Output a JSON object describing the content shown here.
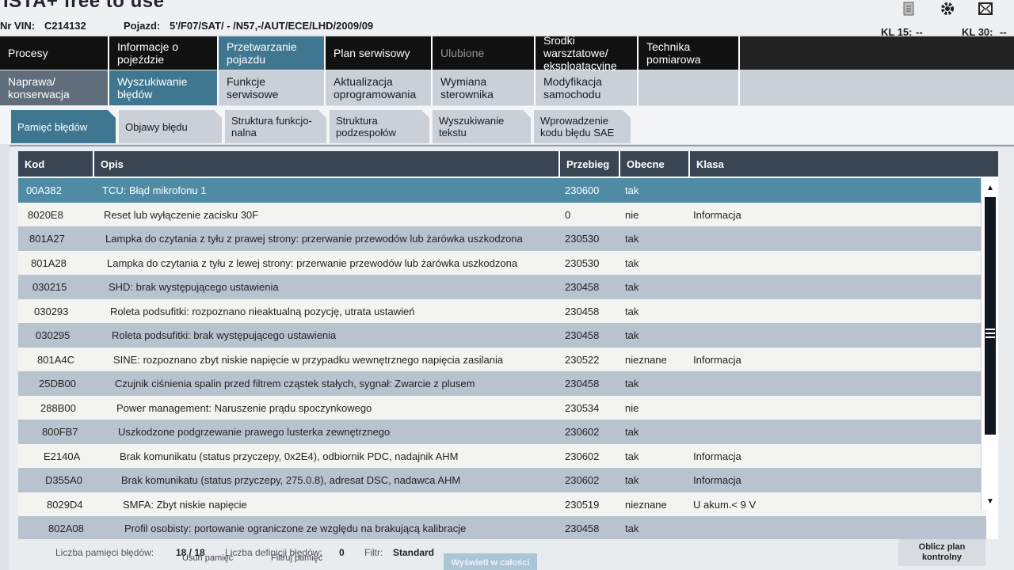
{
  "app": {
    "title": "ISTA+ free to use"
  },
  "top_icons": [
    "document-icon",
    "gear-icon",
    "mail-icon"
  ],
  "vehicle": {
    "vin_label": "Nr VIN:",
    "vin": "C214132",
    "vehicle_label": "Pojazd:",
    "vehicle": "5'/F07/SAT/ - /N57,-/AUT/ECE/LHD/2009/09",
    "kl15_label": "KL 15:",
    "kl15": "--",
    "kl30_label": "KL 30:",
    "kl30": "--"
  },
  "nav_main": [
    {
      "label": "Procesy"
    },
    {
      "label": "Informacje o pojeździe"
    },
    {
      "label": "Przetwarzanie pojazdu"
    },
    {
      "label": "Plan serwisowy"
    },
    {
      "label": "Ulubione"
    },
    {
      "label": "Środki warsztatowe/ eksploatacyjne"
    },
    {
      "label": "Technika pomiarowa"
    }
  ],
  "nav_sub": [
    {
      "label": "Naprawa/ konserwacja"
    },
    {
      "label": "Wyszukiwanie błędów"
    },
    {
      "label": "Funkcje serwisowe"
    },
    {
      "label": "Aktualizacja oprogramowania"
    },
    {
      "label": "Wymiana sterownika"
    },
    {
      "label": "Modyfikacja samochodu"
    }
  ],
  "subtabs": [
    {
      "label": "Pamięć błędów"
    },
    {
      "label": "Objawy błędu"
    },
    {
      "label": "Struktura funkcjo- nalna"
    },
    {
      "label": "Struktura podzespołów"
    },
    {
      "label": "Wyszukiwanie tekstu"
    },
    {
      "label": "Wprowadzenie kodu błędu SAE"
    }
  ],
  "table": {
    "headers": {
      "code": "Kod",
      "desc": "Opis",
      "mileage": "Przebieg",
      "present": "Obecne",
      "class": "Klasa"
    },
    "rows": [
      {
        "code": "00A382",
        "desc": "TCU: Błąd mikrofonu 1",
        "mileage": "230600",
        "present": "tak",
        "class": ""
      },
      {
        "code": "8020E8",
        "desc": "Reset lub wyłączenie zacisku 30F",
        "mileage": "0",
        "present": "nie",
        "class": "Informacja"
      },
      {
        "code": "801A27",
        "desc": "Lampka do czytania z tyłu z prawej strony: przerwanie przewodów lub żarówka uszkodzona",
        "mileage": "230530",
        "present": "tak",
        "class": ""
      },
      {
        "code": "801A28",
        "desc": "Lampka do czytania z tyłu z lewej strony: przerwanie przewodów lub żarówka uszkodzona",
        "mileage": "230530",
        "present": "tak",
        "class": ""
      },
      {
        "code": "030215",
        "desc": "SHD: brak występującego ustawienia",
        "mileage": "230458",
        "present": "tak",
        "class": ""
      },
      {
        "code": "030293",
        "desc": "Roleta podsufitki: rozpoznano nieaktualną pozycję, utrata ustawień",
        "mileage": "230458",
        "present": "tak",
        "class": ""
      },
      {
        "code": "030295",
        "desc": "Roleta podsufitki: brak występującego ustawienia",
        "mileage": "230458",
        "present": "tak",
        "class": ""
      },
      {
        "code": "801A4C",
        "desc": "SINE: rozpoznano zbyt niskie napięcie w przypadku wewnętrznego napięcia zasilania",
        "mileage": "230522",
        "present": "nieznane",
        "class": "Informacja"
      },
      {
        "code": "25DB00",
        "desc": "Czujnik ciśnienia spalin przed filtrem cząstek stałych, sygnał: Zwarcie z plusem",
        "mileage": "230458",
        "present": "tak",
        "class": ""
      },
      {
        "code": "288B00",
        "desc": "Power management: Naruszenie prądu spoczynkowego",
        "mileage": "230534",
        "present": "nie",
        "class": ""
      },
      {
        "code": "800FB7",
        "desc": "Uszkodzone podgrzewanie prawego lusterka zewnętrznego",
        "mileage": "230602",
        "present": "tak",
        "class": ""
      },
      {
        "code": "E2140A",
        "desc": "Brak komunikatu (status przyczepy, 0x2E4), odbiornik PDC, nadajnik AHM",
        "mileage": "230602",
        "present": "tak",
        "class": "Informacja"
      },
      {
        "code": "D355A0",
        "desc": "Brak komunikatu (status przyczepy, 275.0.8), adresat DSC, nadawca AHM",
        "mileage": "230602",
        "present": "tak",
        "class": "Informacja"
      },
      {
        "code": "8029D4",
        "desc": "SMFA: Zbyt niskie napięcie",
        "mileage": "230519",
        "present": "nieznane",
        "class": "U akum.< 9 V"
      },
      {
        "code": "802A08",
        "desc": "Profil osobisty: portowanie ograniczone ze względu na brakującą kalibracje",
        "mileage": "230458",
        "present": "tak",
        "class": ""
      }
    ]
  },
  "footer": {
    "count_label": "Liczba pamięci błędów:",
    "count": "18 / 18",
    "def_label": "Liczba definicji błędów:",
    "def": "0",
    "filter_label": "Filtr:",
    "filter": "Standard",
    "btn_delete": "Usuń pamięć",
    "btn_filter": "Filtruj pamięć",
    "btn_show": "Wyświetl w całości",
    "btn_calc": "Oblicz plan kontrolny"
  }
}
